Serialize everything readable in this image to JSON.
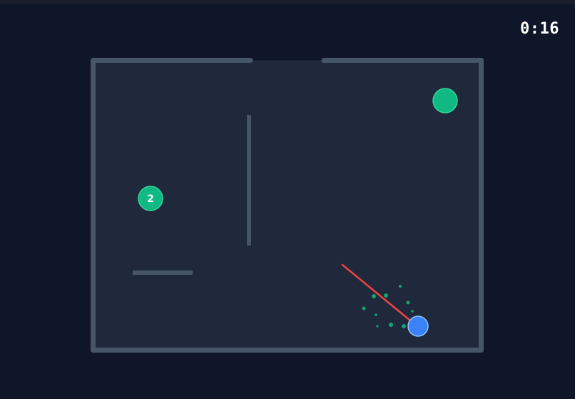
{
  "hud": {
    "timer": "0:16"
  },
  "targets": [
    {
      "label": "2"
    },
    {
      "label": ""
    }
  ],
  "colors": {
    "background": "#0f1629",
    "arena_fill": "#1f293b",
    "wall": "#475569",
    "target": "#10b981",
    "target_stroke": "#34d399",
    "player": "#3b82f6",
    "player_stroke": "#93c5fd",
    "aim_line": "#ef4444",
    "particles": "#10b981"
  },
  "icons": {
    "player": "player-ball-icon",
    "target": "target-ball-icon"
  }
}
